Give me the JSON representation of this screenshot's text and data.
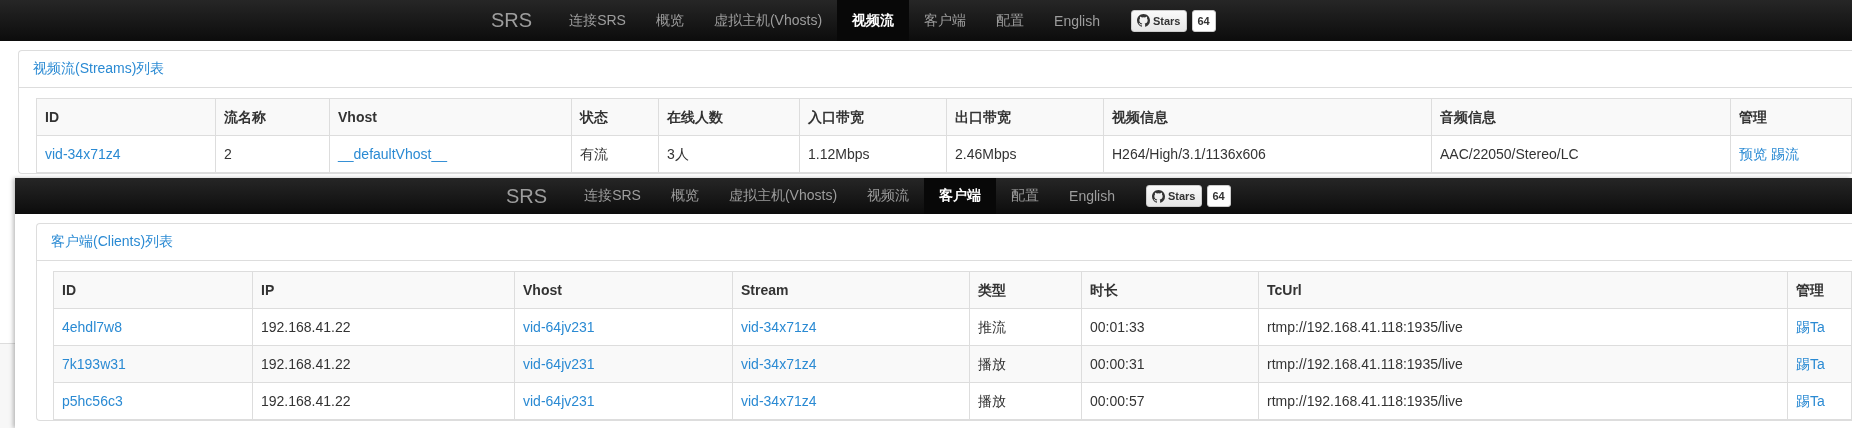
{
  "screens": [
    {
      "nav": {
        "brand": "SRS",
        "items": [
          {
            "label": "连接SRS",
            "selected": false
          },
          {
            "label": "概览",
            "selected": false
          },
          {
            "label": "虚拟主机(Vhosts)",
            "selected": false
          },
          {
            "label": "视频流",
            "selected": true
          },
          {
            "label": "客户端",
            "selected": false
          },
          {
            "label": "配置",
            "selected": false
          },
          {
            "label": "English",
            "selected": false
          }
        ],
        "stars": {
          "label": "Stars",
          "count": "64"
        }
      },
      "panel": {
        "title": "视频流(Streams)列表",
        "table": {
          "columns": [
            "ID",
            "流名称",
            "Vhost",
            "状态",
            "在线人数",
            "入口带宽",
            "出口带宽",
            "视频信息",
            "音频信息",
            "管理"
          ],
          "rows": [
            [
              {
                "kind": "link",
                "text": "vid-34x71z4"
              },
              {
                "kind": "text",
                "text": "2"
              },
              {
                "kind": "link",
                "text": "__defaultVhost__"
              },
              {
                "kind": "text",
                "text": "有流"
              },
              {
                "kind": "text",
                "text": "3人"
              },
              {
                "kind": "text",
                "text": "1.12Mbps"
              },
              {
                "kind": "text",
                "text": "2.46Mbps"
              },
              {
                "kind": "text",
                "text": "H264/High/3.1/1136x606"
              },
              {
                "kind": "text",
                "text": "AAC/22050/Stereo/LC"
              },
              {
                "kind": "links",
                "links": [
                  "预览",
                  "踢流"
                ]
              }
            ]
          ]
        }
      }
    },
    {
      "nav": {
        "brand": "SRS",
        "items": [
          {
            "label": "连接SRS",
            "selected": false
          },
          {
            "label": "概览",
            "selected": false
          },
          {
            "label": "虚拟主机(Vhosts)",
            "selected": false
          },
          {
            "label": "视频流",
            "selected": false
          },
          {
            "label": "客户端",
            "selected": true
          },
          {
            "label": "配置",
            "selected": false
          },
          {
            "label": "English",
            "selected": false
          }
        ],
        "stars": {
          "label": "Stars",
          "count": "64"
        }
      },
      "panel": {
        "title": "客户端(Clients)列表",
        "table": {
          "columns": [
            "ID",
            "IP",
            "Vhost",
            "Stream",
            "类型",
            "时长",
            "TcUrl",
            "管理"
          ],
          "rows": [
            [
              {
                "kind": "link",
                "text": "4ehdl7w8"
              },
              {
                "kind": "text",
                "text": "192.168.41.22"
              },
              {
                "kind": "link",
                "text": "vid-64jv231"
              },
              {
                "kind": "link",
                "text": "vid-34x71z4"
              },
              {
                "kind": "text",
                "text": "推流"
              },
              {
                "kind": "text",
                "text": "00:01:33"
              },
              {
                "kind": "text",
                "text": "rtmp://192.168.41.118:1935/live"
              },
              {
                "kind": "link",
                "text": "踢Ta"
              }
            ],
            [
              {
                "kind": "link",
                "text": "7k193w31"
              },
              {
                "kind": "text",
                "text": "192.168.41.22"
              },
              {
                "kind": "link",
                "text": "vid-64jv231"
              },
              {
                "kind": "link",
                "text": "vid-34x71z4"
              },
              {
                "kind": "text",
                "text": "播放"
              },
              {
                "kind": "text",
                "text": "00:00:31"
              },
              {
                "kind": "text",
                "text": "rtmp://192.168.41.118:1935/live"
              },
              {
                "kind": "link",
                "text": "踢Ta"
              }
            ],
            [
              {
                "kind": "link",
                "text": "p5hc56c3"
              },
              {
                "kind": "text",
                "text": "192.168.41.22"
              },
              {
                "kind": "link",
                "text": "vid-64jv231"
              },
              {
                "kind": "link",
                "text": "vid-34x71z4"
              },
              {
                "kind": "text",
                "text": "播放"
              },
              {
                "kind": "text",
                "text": "00:00:57"
              },
              {
                "kind": "text",
                "text": "rtmp://192.168.41.118:1935/live"
              },
              {
                "kind": "link",
                "text": "踢Ta"
              }
            ]
          ]
        }
      }
    }
  ]
}
